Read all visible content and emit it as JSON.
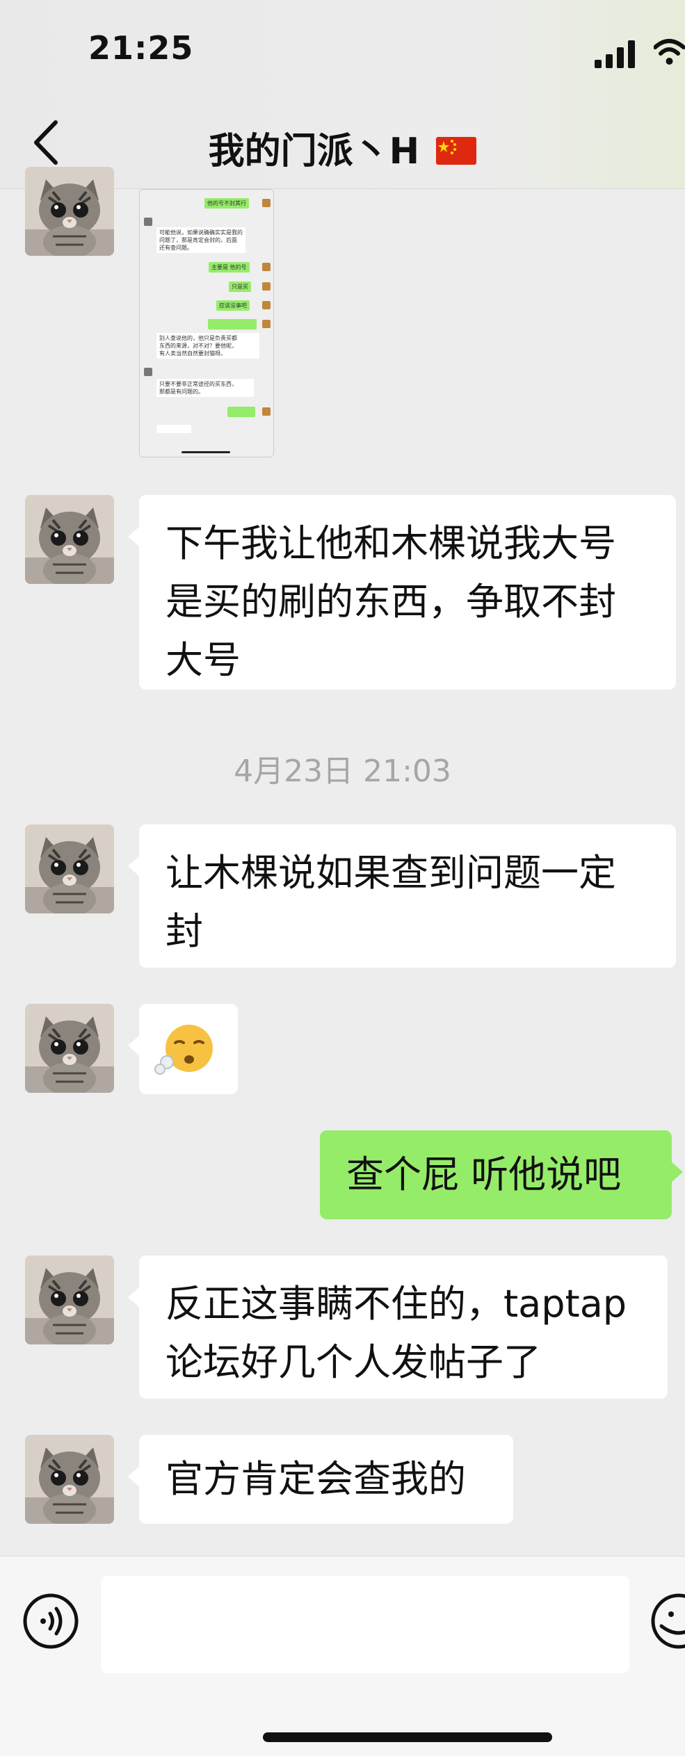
{
  "status_bar": {
    "time": "21:25"
  },
  "header": {
    "title": "我的门派丶H"
  },
  "messages": [
    {
      "text": "下午我让他和木棵说我大号\n是买的刷的东西，争取不封\n大号"
    },
    {
      "text": "让木棵说如果查到问题一定\n封"
    },
    {
      "emoji": "😮‍💨"
    },
    {
      "text": "查个屁  听他说吧"
    },
    {
      "text": "反正这事瞒不住的，taptap\n论坛好几个人发帖子了"
    },
    {
      "text": "官方肯定会查我的"
    }
  ],
  "timestamp": "4月23日 21:03",
  "thumbnail": {
    "lines": [
      "他的号不封其行",
      "可能他说，如果说确确实实是我的\n问题了，那是肯定会封的，后面\n还有查问题。",
      "主要是 他的号",
      "只是买",
      "应该没事吧",
      "别人查说他的，他只是负责买都\n东西的来源，对不对？要他呢，\n有人卖当然自然要封猫呀。",
      "只要不要非正常途径的买东西，\n那都是有问题的。"
    ]
  },
  "composer": {
    "placeholder": ""
  },
  "colors": {
    "self_bubble": "#95ec69",
    "other_bubble": "#ffffff",
    "background": "#ededed"
  }
}
